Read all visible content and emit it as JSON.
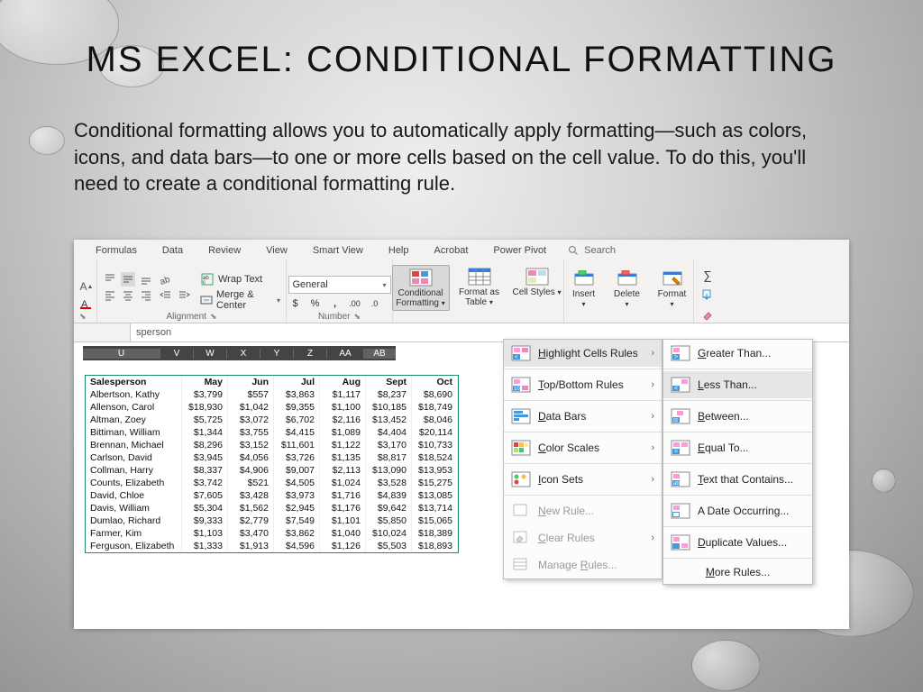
{
  "slide": {
    "title": "MS EXCEL:   CONDITIONAL FORMATTING",
    "body": "Conditional formatting allows you to automatically apply formatting—such as colors, icons, and data bars—to one or more cells based on the cell value. To do this, you'll need to create a conditional formatting rule."
  },
  "ribbon": {
    "tabs": [
      "Formulas",
      "Data",
      "Review",
      "View",
      "Smart View",
      "Help",
      "Acrobat",
      "Power Pivot"
    ],
    "search_placeholder": "Search",
    "wrap_text": "Wrap Text",
    "merge_center": "Merge & Center",
    "alignment_label": "Alignment",
    "number_format": "General",
    "number_label": "Number",
    "cond_fmt": "Conditional Formatting",
    "fmt_table": "Format as Table",
    "cell_styles": "Cell Styles",
    "insert": "Insert",
    "delete": "Delete",
    "format": "Format"
  },
  "formula_bar": {
    "value": "sperson"
  },
  "column_headers": [
    "U",
    "V",
    "W",
    "X",
    "Y",
    "Z",
    "AA",
    "AB"
  ],
  "table": {
    "headers": [
      "Salesperson",
      "May",
      "Jun",
      "Jul",
      "Aug",
      "Sept",
      "Oct"
    ],
    "rows": [
      [
        "Albertson, Kathy",
        "$3,799",
        "$557",
        "$3,863",
        "$1,117",
        "$8,237",
        "$8,690"
      ],
      [
        "Allenson, Carol",
        "$18,930",
        "$1,042",
        "$9,355",
        "$1,100",
        "$10,185",
        "$18,749"
      ],
      [
        "Altman, Zoey",
        "$5,725",
        "$3,072",
        "$6,702",
        "$2,116",
        "$13,452",
        "$8,046"
      ],
      [
        "Bittiman, William",
        "$1,344",
        "$3,755",
        "$4,415",
        "$1,089",
        "$4,404",
        "$20,114"
      ],
      [
        "Brennan, Michael",
        "$8,296",
        "$3,152",
        "$11,601",
        "$1,122",
        "$3,170",
        "$10,733"
      ],
      [
        "Carlson, David",
        "$3,945",
        "$4,056",
        "$3,726",
        "$1,135",
        "$8,817",
        "$18,524"
      ],
      [
        "Collman, Harry",
        "$8,337",
        "$4,906",
        "$9,007",
        "$2,113",
        "$13,090",
        "$13,953"
      ],
      [
        "Counts, Elizabeth",
        "$3,742",
        "$521",
        "$4,505",
        "$1,024",
        "$3,528",
        "$15,275"
      ],
      [
        "David, Chloe",
        "$7,605",
        "$3,428",
        "$3,973",
        "$1,716",
        "$4,839",
        "$13,085"
      ],
      [
        "Davis, William",
        "$5,304",
        "$1,562",
        "$2,945",
        "$1,176",
        "$9,642",
        "$13,714"
      ],
      [
        "Dumlao, Richard",
        "$9,333",
        "$2,779",
        "$7,549",
        "$1,101",
        "$5,850",
        "$15,065"
      ],
      [
        "Farmer, Kim",
        "$1,103",
        "$3,470",
        "$3,862",
        "$1,040",
        "$10,024",
        "$18,389"
      ],
      [
        "Ferguson, Elizabeth",
        "$1,333",
        "$1,913",
        "$4,596",
        "$1,126",
        "$5,503",
        "$18,893"
      ]
    ]
  },
  "cf_menu": {
    "highlight": "Highlight Cells Rules",
    "topbottom": "Top/Bottom Rules",
    "databars": "Data Bars",
    "colorscales": "Color Scales",
    "iconsets": "Icon Sets",
    "newrule": "New Rule...",
    "clear": "Clear Rules",
    "manage": "Manage Rules..."
  },
  "hl_menu": {
    "greater": "Greater Than...",
    "less": "Less Than...",
    "between": "Between...",
    "equal": "Equal To...",
    "text": "Text that Contains...",
    "date": "A Date Occurring...",
    "dup": "Duplicate Values...",
    "more": "More Rules..."
  }
}
